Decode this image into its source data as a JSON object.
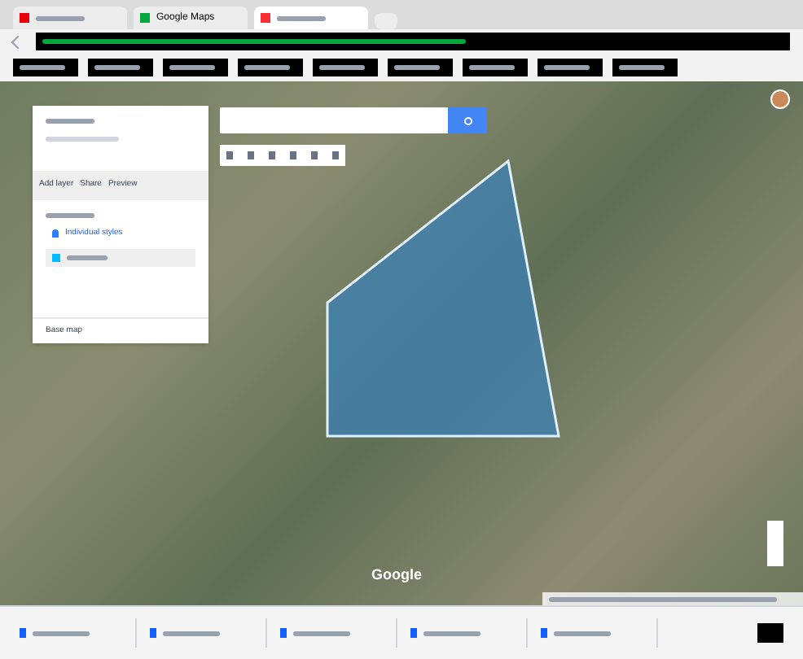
{
  "browser": {
    "tabs": [
      {
        "kind": "mail",
        "selected": false
      },
      {
        "kind": "maps",
        "label": "Google Maps",
        "selected": false
      },
      {
        "kind": "mymaps",
        "selected": true
      }
    ]
  },
  "map": {
    "logo": "Google",
    "panel": {
      "actions": [
        "Add layer",
        "Share",
        "Preview"
      ],
      "layer_items": [
        {
          "kind": "styles",
          "label": "Individual styles",
          "selected": false
        },
        {
          "kind": "feature",
          "selected": true
        }
      ],
      "base_map": "Base map"
    }
  },
  "downloads": [
    {
      "kind": "file"
    },
    {
      "kind": "file"
    },
    {
      "kind": "file"
    },
    {
      "kind": "file"
    },
    {
      "kind": "file"
    }
  ]
}
